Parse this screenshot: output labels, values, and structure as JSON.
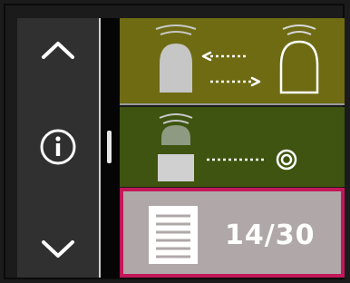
{
  "navigation": {
    "up_icon": "chevron-up-icon",
    "info_icon": "info-icon",
    "down_icon": "chevron-down-icon"
  },
  "cards": [
    {
      "id": "bidirectional-transfer",
      "icon": "tooth-transfer-arrows-icon"
    },
    {
      "id": "target-transfer",
      "icon": "tooth-target-icon"
    },
    {
      "id": "page-counter",
      "icon": "document-lines-icon",
      "counter": "14/30"
    }
  ],
  "colors": {
    "card_1_bg": "#6e6b13",
    "card_2_bg": "#3e5410",
    "card_3_bg": "#b0a8a8",
    "selection_border": "#c2175a"
  }
}
